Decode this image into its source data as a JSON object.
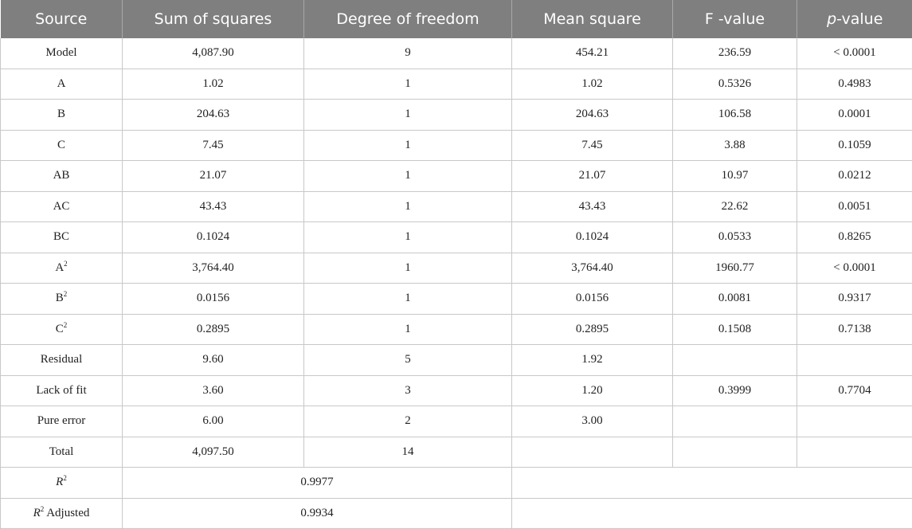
{
  "header": {
    "source": "Source",
    "sum_squares": "Sum of squares",
    "dof": "Degree of freedom",
    "mean_square": "Mean square",
    "f_value": "F -value",
    "p_italic": "p",
    "p_rest": "-value"
  },
  "rows": [
    {
      "source": "Model",
      "ss": "4,087.90",
      "df": "9",
      "ms": "454.21",
      "f": "236.59",
      "p": "< 0.0001"
    },
    {
      "source": "A",
      "ss": "1.02",
      "df": "1",
      "ms": "1.02",
      "f": "0.5326",
      "p": "0.4983"
    },
    {
      "source": "B",
      "ss": "204.63",
      "df": "1",
      "ms": "204.63",
      "f": "106.58",
      "p": "0.0001"
    },
    {
      "source": "C",
      "ss": "7.45",
      "df": "1",
      "ms": "7.45",
      "f": "3.88",
      "p": "0.1059"
    },
    {
      "source": "AB",
      "ss": "21.07",
      "df": "1",
      "ms": "21.07",
      "f": "10.97",
      "p": "0.0212"
    },
    {
      "source": "AC",
      "ss": "43.43",
      "df": "1",
      "ms": "43.43",
      "f": "22.62",
      "p": "0.0051"
    },
    {
      "source": "BC",
      "ss": "0.1024",
      "df": "1",
      "ms": "0.1024",
      "f": "0.0533",
      "p": "0.8265"
    },
    {
      "source": "A",
      "sup": "2",
      "ss": "3,764.40",
      "df": "1",
      "ms": "3,764.40",
      "f": "1960.77",
      "p": "< 0.0001"
    },
    {
      "source": "B",
      "sup": "2",
      "ss": "0.0156",
      "df": "1",
      "ms": "0.0156",
      "f": "0.0081",
      "p": "0.9317"
    },
    {
      "source": "C",
      "sup": "2",
      "ss": "0.2895",
      "df": "1",
      "ms": "0.2895",
      "f": "0.1508",
      "p": "0.7138"
    },
    {
      "source": "Residual",
      "ss": "9.60",
      "df": "5",
      "ms": "1.92",
      "f": "",
      "p": ""
    },
    {
      "source": "Lack of fit",
      "ss": "3.60",
      "df": "3",
      "ms": "1.20",
      "f": "0.3999",
      "p": "0.7704"
    },
    {
      "source": "Pure error",
      "ss": "6.00",
      "df": "2",
      "ms": "3.00",
      "f": "",
      "p": ""
    },
    {
      "source": "Total",
      "ss": "4,097.50",
      "df": "14",
      "ms": "",
      "f": "",
      "p": ""
    }
  ],
  "fit": {
    "r2": {
      "symbol": "R",
      "sup": "2",
      "suffix": "",
      "value": "0.9977"
    },
    "r2_adj": {
      "symbol": "R",
      "sup": "2",
      "suffix": " Adjusted",
      "value": "0.9934"
    }
  }
}
